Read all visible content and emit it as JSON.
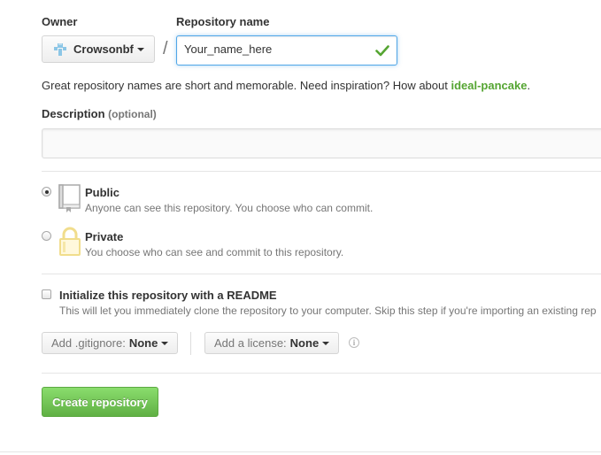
{
  "owner": {
    "label": "Owner",
    "selected": "Crowsonbf",
    "avatar_icon": "identicon-avatar"
  },
  "separator": "/",
  "repo_name": {
    "label": "Repository name",
    "value": "Your_name_here",
    "valid_icon": "checkmark-icon"
  },
  "suggestion": {
    "prefix": "Great repository names are short and memorable. Need inspiration? How about ",
    "name": "ideal-pancake",
    "suffix": "."
  },
  "description": {
    "label": "Description",
    "optional": "(optional)",
    "value": ""
  },
  "visibility": {
    "options": [
      {
        "title": "Public",
        "desc": "Anyone can see this repository. You choose who can commit.",
        "selected": true,
        "icon": "repo-book-icon"
      },
      {
        "title": "Private",
        "desc": "You choose who can see and commit to this repository.",
        "selected": false,
        "icon": "lock-icon"
      }
    ]
  },
  "readme": {
    "title": "Initialize this repository with a README",
    "desc": "This will let you immediately clone the repository to your computer. Skip this step if you're importing an existing rep",
    "checked": false
  },
  "gitignore": {
    "key": "Add .gitignore:",
    "value": "None"
  },
  "license": {
    "key": "Add a license:",
    "value": "None"
  },
  "submit": {
    "label": "Create repository"
  },
  "colors": {
    "accent_green": "#55a532",
    "button_green": "#60b044",
    "focus_blue": "#51a7e8"
  }
}
